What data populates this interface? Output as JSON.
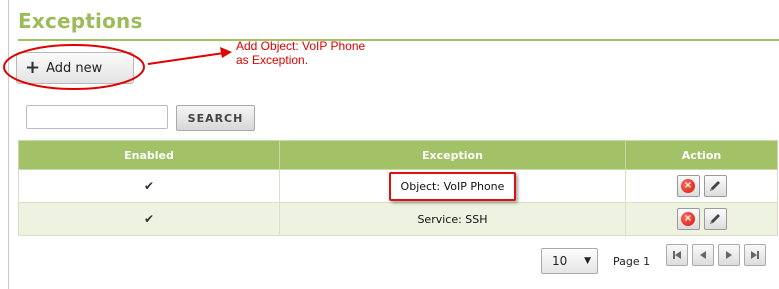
{
  "page": {
    "title": "Exceptions"
  },
  "toolbar": {
    "add_label": "Add new"
  },
  "annotation": {
    "line1": "Add Object: VoIP Phone",
    "line2": "as Exception."
  },
  "search": {
    "value": "",
    "button_label": "SEARCH"
  },
  "table": {
    "headers": {
      "enabled": "Enabled",
      "exception": "Exception",
      "action": "Action"
    },
    "rows": [
      {
        "enabled": "✔",
        "exception": "Object: VoIP Phone"
      },
      {
        "enabled": "✔",
        "exception": "Service: SSH"
      }
    ]
  },
  "pagination": {
    "page_size": "10",
    "page_label": "Page 1"
  },
  "colors": {
    "accent": "#9cbb5a",
    "header_bg": "#a3c167",
    "annotation": "#e10000"
  }
}
